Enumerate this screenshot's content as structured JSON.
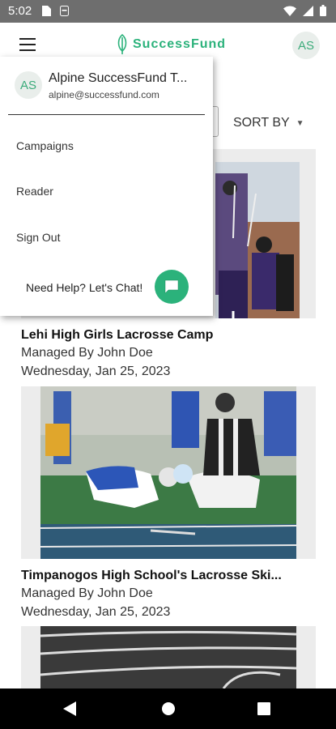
{
  "status_bar": {
    "time": "5:02"
  },
  "app": {
    "brand_name": "SuccessFund",
    "avatar_initials": "AS",
    "accent_color": "#2bb27b"
  },
  "toolbar": {
    "sort_label": "SORT BY"
  },
  "drawer": {
    "avatar_initials": "AS",
    "account_name": "Alpine SuccessFund T...",
    "account_email": "alpine@successfund.com",
    "menu": [
      "Campaigns",
      "Reader",
      "Sign Out"
    ],
    "help_text": "Need Help? Let's Chat!"
  },
  "campaigns": [
    {
      "title": "Lehi High Girls Lacrosse Camp",
      "managed_by": "Managed By John Doe",
      "date": "Wednesday, Jan 25, 2023"
    },
    {
      "title": "Timpanogos High School's Lacrosse Ski...",
      "managed_by": "Managed By John Doe",
      "date": "Wednesday, Jan 25, 2023"
    }
  ],
  "icons": {
    "menu": "hamburger-icon",
    "leaf": "leaf-icon",
    "chat": "chat-icon",
    "dropdown": "caret-down-icon",
    "back": "back-icon",
    "home": "home-icon",
    "recents": "recents-icon"
  }
}
